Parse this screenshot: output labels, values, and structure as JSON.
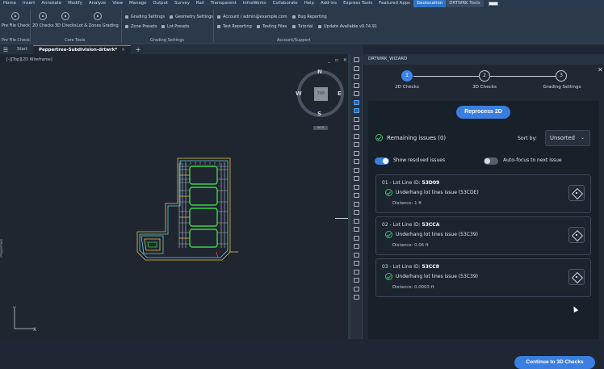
{
  "menu": {
    "items": [
      "Home",
      "Insert",
      "Annotate",
      "Modify",
      "Analyze",
      "View",
      "Manage",
      "Output",
      "Survey",
      "Rail",
      "Transparent",
      "InfraWorks",
      "Collaborate",
      "Help",
      "Add-ins",
      "Express Tools",
      "Featured Apps",
      "Geolocation",
      "DRTWRK Tools"
    ],
    "active_item": "Geolocation"
  },
  "ribbon": {
    "pre_file_check_btn": "Pre File Check",
    "pre_file_check_group": "Pre File Check",
    "core_tools": {
      "label": "Core Tools",
      "buttons": [
        "2D Checks",
        "3D Checks",
        "Lot & Zones Grading"
      ]
    },
    "grading_settings": {
      "label": "Grading Settings",
      "items": [
        "Grading Settings",
        "Geometry Settings",
        "Zone Presets",
        "Lot Presets"
      ]
    },
    "account_support": {
      "label": "Account/Support",
      "items": [
        "Account / admin@example.com",
        "Bug Reporting",
        "Test Reporting",
        "Testing Files",
        "Tutorial",
        "Update Available v0.74.91"
      ]
    }
  },
  "file_tabs": {
    "start": "Start",
    "active": "Peppertree-Subdivision-drtwrk*"
  },
  "viewport": {
    "label": "[-][Top][2D Wireframe]",
    "controls": "_ ▫ ✕",
    "compass": {
      "n": "N",
      "s": "S",
      "e": "E",
      "w": "W"
    },
    "cube_top": "TOP",
    "wcs": "WCS",
    "side_label": "Properties"
  },
  "palette": {
    "title": "DRTWRK_WIZARD",
    "close": "✕",
    "steps": [
      {
        "number": "1",
        "label": "2D Checks"
      },
      {
        "number": "2",
        "label": "3D Checks"
      },
      {
        "number": "3",
        "label": "Grading Settings"
      }
    ],
    "reprocess_label": "Reprocess 2D",
    "remaining_issues": "Remaining issues (0)",
    "sort_by_label": "Sort by:",
    "sort_value": "Unsorted",
    "show_resolved_label": "Show resolved issues",
    "show_resolved_on": true,
    "auto_focus_label": "Auto-focus to next issue",
    "auto_focus_on": false,
    "cards": [
      {
        "index": "01",
        "lot_prefix": "Lot Line ID: ",
        "lot_id": "53D09",
        "issue": "Underhang lot lines issue (53CDE)",
        "distance": "Distance: 1 ft"
      },
      {
        "index": "02",
        "lot_prefix": "Lot Line ID: ",
        "lot_id": "53CCA",
        "issue": "Underhang lot lines issue (53C39)",
        "distance": "Distance: 0.06 ft"
      },
      {
        "index": "03",
        "lot_prefix": "Lot Line ID: ",
        "lot_id": "53CC8",
        "issue": "Underhang lot lines issue (53C39)",
        "distance": "Distance: 0.0003 ft"
      }
    ],
    "continue_label": "Continue to 3D Checks"
  },
  "colors": {
    "accent": "#3a7fe0",
    "success": "#3fbf6a",
    "drawing_yellow": "#e8c23a",
    "drawing_green": "#3fd14a",
    "drawing_cyan": "#6fc7d8"
  }
}
